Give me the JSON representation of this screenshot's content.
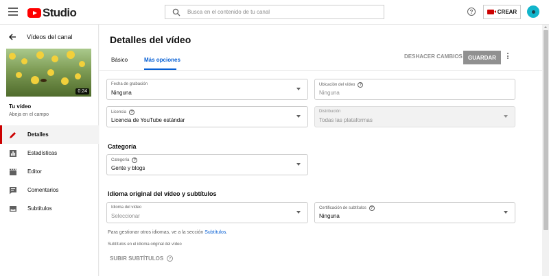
{
  "header": {
    "logo_text": "Studio",
    "search_placeholder": "Busca en el contenido de tu canal",
    "help_glyph": "?",
    "create_label": "CREAR"
  },
  "sidebar": {
    "back_label": "Vídeos del canal",
    "thumbnail_duration": "0:24",
    "your_video_label": "Tu vídeo",
    "video_name": "Abeja en el campo",
    "nav": [
      {
        "label": "Detalles",
        "icon": "pencil-icon",
        "active": true
      },
      {
        "label": "Estadísticas",
        "icon": "bar-chart-icon",
        "active": false
      },
      {
        "label": "Editor",
        "icon": "clapperboard-icon",
        "active": false
      },
      {
        "label": "Comentarios",
        "icon": "comment-icon",
        "active": false
      },
      {
        "label": "Subtítulos",
        "icon": "subtitles-icon",
        "active": false
      }
    ]
  },
  "main": {
    "title": "Detalles del vídeo",
    "tabs": [
      {
        "label": "Básico",
        "active": false
      },
      {
        "label": "Más opciones",
        "active": true
      }
    ],
    "undo_label": "DESHACER CAMBIOS",
    "save_label": "GUARDAR",
    "fields": {
      "recording_date": {
        "label": "Fecha de grabación",
        "value": "Ninguna"
      },
      "location": {
        "label": "Ubicación del vídeo",
        "placeholder": "Ninguna"
      },
      "license": {
        "label": "Licencia",
        "value": "Licencia de YouTube estándar"
      },
      "distribution": {
        "label": "Distribución",
        "value": "Todas las plataformas"
      },
      "category": {
        "label": "Categoría",
        "value": "Gente y blogs"
      },
      "video_language": {
        "label": "Idioma del vídeo",
        "value": "Seleccionar"
      },
      "caption_cert": {
        "label": "Certificación de subtítulos",
        "value": "Ninguna"
      }
    },
    "category_section_title": "Categoría",
    "language_section_title": "Idioma original del vídeo y subtítulos",
    "note_text": "Para gestionar otros idiomas, ve a la sección ",
    "note_link": "Subtítulos",
    "note_end": ".",
    "subtitles_note": "Subtítulos en el idioma original del vídeo",
    "upload_label": "SUBIR SUBTÍTULOS"
  },
  "colors": {
    "brand_red": "#ff0000",
    "accent_blue": "#065fd4",
    "active_red": "#cc0000"
  }
}
